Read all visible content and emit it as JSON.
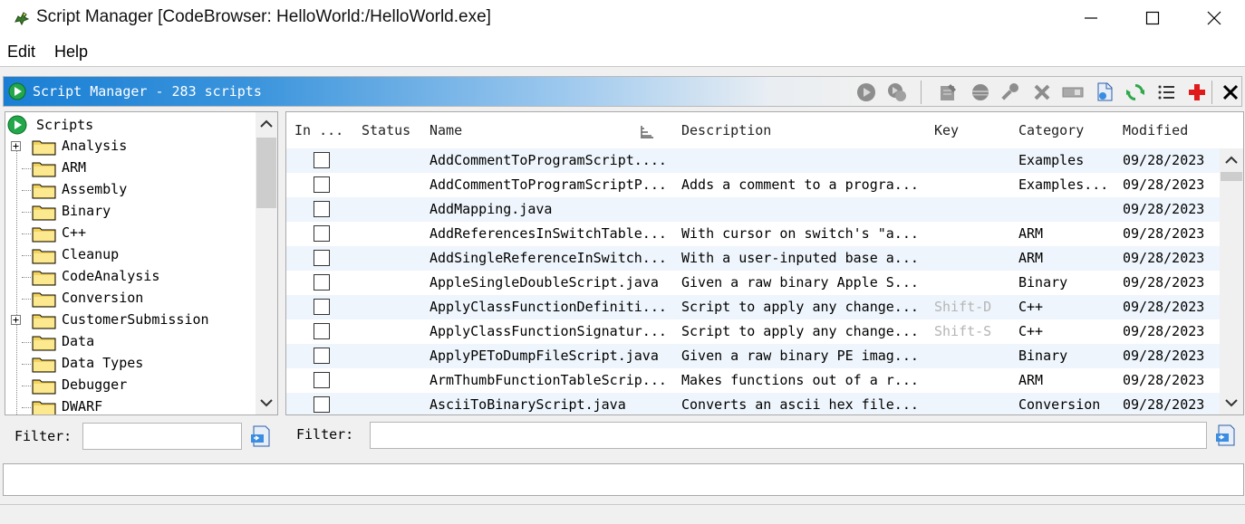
{
  "window": {
    "title": "Script Manager [CodeBrowser: HelloWorld:/HelloWorld.exe]"
  },
  "menu": [
    "Edit",
    "Help"
  ],
  "header": {
    "title": "Script Manager - 283 scripts"
  },
  "tree": {
    "root": "Scripts",
    "items": [
      {
        "label": "Analysis",
        "expandable": true
      },
      {
        "label": "ARM",
        "expandable": false
      },
      {
        "label": "Assembly",
        "expandable": false
      },
      {
        "label": "Binary",
        "expandable": false
      },
      {
        "label": "C++",
        "expandable": false
      },
      {
        "label": "Cleanup",
        "expandable": false
      },
      {
        "label": "CodeAnalysis",
        "expandable": false
      },
      {
        "label": "Conversion",
        "expandable": false
      },
      {
        "label": "CustomerSubmission",
        "expandable": true
      },
      {
        "label": "Data",
        "expandable": false
      },
      {
        "label": "Data Types",
        "expandable": false
      },
      {
        "label": "Debugger",
        "expandable": false
      },
      {
        "label": "DWARF",
        "expandable": false
      }
    ]
  },
  "table": {
    "columns": [
      "In ...",
      "Status",
      "Name",
      "Description",
      "Key",
      "Category",
      "Modified"
    ],
    "rows": [
      {
        "name": "AddCommentToProgramScript....",
        "description": "",
        "key": "",
        "category": "Examples",
        "modified": "09/28/2023"
      },
      {
        "name": "AddCommentToProgramScriptP...",
        "description": "Adds a comment to a progra...",
        "key": "",
        "category": "Examples...",
        "modified": "09/28/2023"
      },
      {
        "name": "AddMapping.java",
        "description": "",
        "key": "",
        "category": "",
        "modified": "09/28/2023"
      },
      {
        "name": "AddReferencesInSwitchTable...",
        "description": "With cursor on switch's \"a...",
        "key": "",
        "category": "ARM",
        "modified": "09/28/2023"
      },
      {
        "name": "AddSingleReferenceInSwitch...",
        "description": "With a user-inputed base a...",
        "key": "",
        "category": "ARM",
        "modified": "09/28/2023"
      },
      {
        "name": "AppleSingleDoubleScript.java",
        "description": "Given a raw binary Apple S...",
        "key": "",
        "category": "Binary",
        "modified": "09/28/2023"
      },
      {
        "name": "ApplyClassFunctionDefiniti...",
        "description": "Script to apply any change...",
        "key": "Shift-D",
        "category": "C++",
        "modified": "09/28/2023"
      },
      {
        "name": "ApplyClassFunctionSignatur...",
        "description": "Script to apply any change...",
        "key": "Shift-S",
        "category": "C++",
        "modified": "09/28/2023"
      },
      {
        "name": "ApplyPEToDumpFileScript.java",
        "description": "Given a raw binary PE imag...",
        "key": "",
        "category": "Binary",
        "modified": "09/28/2023"
      },
      {
        "name": "ArmThumbFunctionTableScrip...",
        "description": "Makes functions out of a r...",
        "key": "",
        "category": "ARM",
        "modified": "09/28/2023"
      },
      {
        "name": "AsciiToBinaryScript.java",
        "description": "Converts an ascii hex file...",
        "key": "",
        "category": "Conversion",
        "modified": "09/28/2023"
      }
    ]
  },
  "filters": {
    "tree_label": "Filter:",
    "table_label": "Filter:",
    "tree_value": "",
    "table_value": ""
  },
  "colors": {
    "accent_blue": "#1a7fd4",
    "run_green": "#22a84a",
    "folder_yellow": "#f3d25a"
  }
}
